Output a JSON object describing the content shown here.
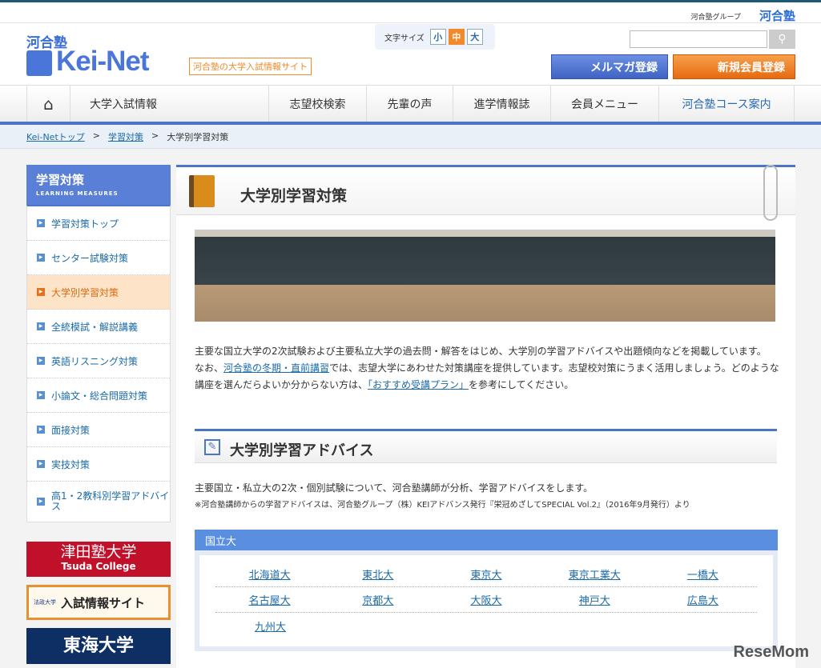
{
  "header": {
    "group_label": "河合塾グループ",
    "group_logo": "河合塾",
    "logo_top": "河合塾",
    "logo": "Kei-Net",
    "tagline": "河合塾の大学入試情報サイト",
    "font_size_label": "文字サイズ",
    "font_sizes": [
      "小",
      "中",
      "大"
    ],
    "search_placeholder": "",
    "mail_button": "メルマガ登録",
    "register_button": "新規会員登録"
  },
  "nav": {
    "items": [
      "大学入試情報",
      "志望校検索",
      "先輩の声",
      "進学情報誌",
      "会員メニュー",
      "河合塾コース案内"
    ]
  },
  "breadcrumb": [
    "Kei-Netトップ",
    "学習対策",
    "大学別学習対策"
  ],
  "sidebar": {
    "title": "学習対策",
    "subtitle": "LEARNING MEASURES",
    "items": [
      "学習対策トップ",
      "センター試験対策",
      "大学別学習対策",
      "全統模試・解説講義",
      "英語リスニング対策",
      "小論文・総合問題対策",
      "面接対策",
      "実技対策",
      "高1・2教科別学習アドバイス"
    ],
    "banners": [
      {
        "title": "津田塾大学",
        "sub": "Tsuda College"
      },
      {
        "title": "入試情報サイト",
        "sub": "法政大学"
      },
      {
        "title": "東海大学"
      }
    ]
  },
  "main": {
    "title": "大学別学習対策",
    "intro1": "主要な国立大学の2次試験および主要私立大学の過去問・解答をはじめ、大学別の学習アドバイスや出題傾向などを掲載しています。",
    "intro2a": "なお、",
    "intro2link": "河合塾の冬期・直前講習",
    "intro2b": "では、志望大学にあわせた対策講座を提供しています。志望校対策にうまく活用しましょう。どのような講座を選んだらよいか分からない方は、",
    "intro2link2": "「おすすめ受講プラン」",
    "intro2c": "を参考にしてください。",
    "section_title": "大学別学習アドバイス",
    "desc": "主要国立・私立大の2次・個別試験について、河合塾講師が分析、学習アドバイスをします。",
    "note": "※河合塾講師からの学習アドバイスは、河合塾グループ（株）KEIアドバンス発行『栄冠めざしてSPECIAL Vol.2』（2016年9月発行）より",
    "category": "国立大",
    "universities": [
      [
        "北海道大",
        "東北大",
        "東京大",
        "東京工業大",
        "一橋大"
      ],
      [
        "名古屋大",
        "京都大",
        "大阪大",
        "神戸大",
        "広島大"
      ],
      [
        "九州大"
      ]
    ]
  },
  "watermark": "ReseMom"
}
